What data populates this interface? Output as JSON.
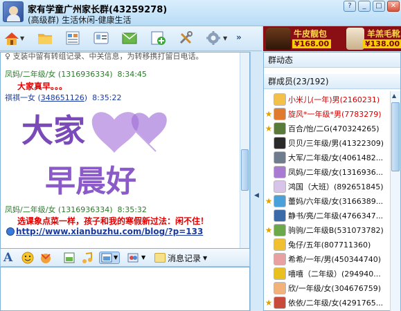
{
  "window": {
    "group_name": "家有学童广州家长群(43259278)",
    "group_sub": "(高级群) 生活休闲-健康生活",
    "buttons": {
      "help": "?",
      "minimize": "_",
      "maximize": "□",
      "close": "✕"
    }
  },
  "toolbar": {
    "more": "»",
    "icons": [
      "home-icon",
      "folder-icon",
      "album-icon",
      "card-icon",
      "mail-icon",
      "add-icon",
      "tools-icon",
      "settings-icon"
    ]
  },
  "ad": {
    "item1": "牛皮靓包",
    "price1": "¥168.00",
    "item2": "羊羔毛靴",
    "price2": "¥138.00",
    "colors": {
      "bg": "#8a0f14",
      "tag": "#f7d000"
    }
  },
  "chat": {
    "notice": "♀ 支装中留有转组记录、中关信息，为转移携打留日电话。",
    "messages": [
      {
        "sender": "凤妈/二年级/女",
        "qq": "(1316936334)",
        "time": "8:34:45",
        "text": "大家真早。。。"
      },
      {
        "sender": "祺祺一女",
        "qq": "348651126",
        "time": "8:35:22",
        "sticker": "大家早晨好"
      },
      {
        "sender": "凤妈/二年级/女",
        "qq": "(1316936334)",
        "time": "8:35:32",
        "text": "选课象点菜一样，孩子和我的寒假新过法：闲不住！",
        "link": "http://www.xianbuzhu.com/blog/?p=133"
      }
    ],
    "sticker_text": {
      "line1": "大家",
      "line2": "早晨好"
    }
  },
  "input_toolbar": {
    "message_log": "消息记录",
    "icons": [
      "font-icon",
      "emoji-icon",
      "magic-icon",
      "screenshot-icon",
      "music-icon",
      "picture-icon",
      "transfer-icon",
      "message-log-icon"
    ]
  },
  "right_panel": {
    "dynamics": "群动态",
    "members_title": "群成员(23/192)",
    "members": [
      {
        "name": "小米儿(一年)男(2160231)",
        "red": true,
        "star": false,
        "color": "#f3c04a"
      },
      {
        "name": "旋风*一年级*男(7783279)",
        "red": true,
        "star": true,
        "color": "#e07a2e"
      },
      {
        "name": "百合/怡/二G(470324265)",
        "red": false,
        "star": true,
        "color": "#5a7a3a"
      },
      {
        "name": "贝贝/三年级/男(41322309)",
        "red": false,
        "star": false,
        "color": "#2a2a2a"
      },
      {
        "name": "大军/二年级/女(4061482...",
        "red": false,
        "star": false,
        "color": "#6e7c8e"
      },
      {
        "name": "凤妈/二年级/女(1316936...",
        "red": false,
        "star": false,
        "color": "#a87ad2"
      },
      {
        "name": "鸿国（大班）(892651845)",
        "red": false,
        "star": false,
        "color": "#d8c4e8"
      },
      {
        "name": "蕾妈/六年级/女(3166389...",
        "red": false,
        "star": true,
        "color": "#4aa0d8"
      },
      {
        "name": "静书/亮/二年级(4766347...",
        "red": false,
        "star": false,
        "color": "#3a6aa8"
      },
      {
        "name": "驹驹/二年级B(531073782)",
        "red": false,
        "star": true,
        "color": "#6aa84a"
      },
      {
        "name": "兔仔/五年(807711360)",
        "red": false,
        "star": false,
        "color": "#f0c030"
      },
      {
        "name": "希希/一年/男(450344740)",
        "red": false,
        "star": false,
        "color": "#e8a0a0"
      },
      {
        "name": "嘻嘻（二年级）(294940...",
        "red": false,
        "star": false,
        "color": "#e8c020"
      },
      {
        "name": "欣/一年级/女(304676759)",
        "red": false,
        "star": false,
        "color": "#f2b27a"
      },
      {
        "name": "依依/二年级/女(4291765...",
        "red": false,
        "star": true,
        "color": "#c84a3a"
      }
    ]
  }
}
